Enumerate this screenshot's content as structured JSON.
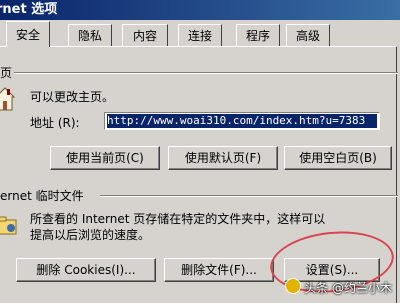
{
  "window": {
    "title": "rnet 选项"
  },
  "tabs": [
    {
      "label": "安全"
    },
    {
      "label": "隐私"
    },
    {
      "label": "内容"
    },
    {
      "label": "连接"
    },
    {
      "label": "程序"
    },
    {
      "label": "高级"
    }
  ],
  "homepage": {
    "group_title": "页",
    "description": "可以更改主页。",
    "address_label": "地址 (R):",
    "address_value": "http://www.woai310.com/index.htm?u=7383",
    "buttons": {
      "use_current": "使用当前页(C)",
      "use_default": "使用默认页(F)",
      "use_blank": "使用空白页(B)"
    }
  },
  "temp_files": {
    "group_title": "ernet 临时文件",
    "description_line1": "所查看的 Internet 页存储在特定的文件夹中，这样可以",
    "description_line2": "提高以后浏览的速度。",
    "buttons": {
      "delete_cookies": "删除 Cookies(I)...",
      "delete_files": "删除文件(F)...",
      "settings": "设置(S)..."
    }
  },
  "watermark": {
    "text": "头条 @约兰小木"
  },
  "colors": {
    "highlight": "#0a246a",
    "annotation_circle": "#d9454f",
    "titlebar": "#0a246a"
  }
}
